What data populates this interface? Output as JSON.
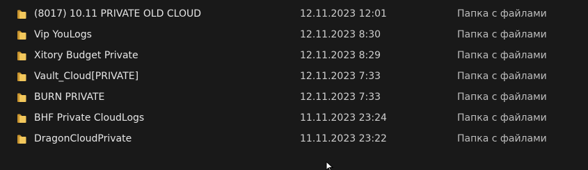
{
  "rows": [
    {
      "name": "(8017) 10.11 PRIVATE OLD CLOUD",
      "modified": "12.11.2023 12:01",
      "type": "Папка с файлами",
      "icon": "folder-icon"
    },
    {
      "name": "Vip YouLogs",
      "modified": "12.11.2023 8:30",
      "type": "Папка с файлами",
      "icon": "folder-icon"
    },
    {
      "name": "Xitory Budget Private",
      "modified": "12.11.2023 8:29",
      "type": "Папка с файлами",
      "icon": "folder-icon"
    },
    {
      "name": "Vault_Cloud[PRIVATE]",
      "modified": "12.11.2023 7:33",
      "type": "Папка с файлами",
      "icon": "folder-icon"
    },
    {
      "name": "BURN PRIVATE",
      "modified": "12.11.2023 7:33",
      "type": "Папка с файлами",
      "icon": "folder-icon"
    },
    {
      "name": "BHF Private CloudLogs",
      "modified": "11.11.2023 23:24",
      "type": "Папка с файлами",
      "icon": "folder-icon"
    },
    {
      "name": "DragonCloudPrivate",
      "modified": "11.11.2023 23:22",
      "type": "Папка с файлами",
      "icon": "folder-icon"
    }
  ],
  "colors": {
    "background": "#191919",
    "text": "#e6e6e6",
    "folder": "#e8b84a"
  }
}
